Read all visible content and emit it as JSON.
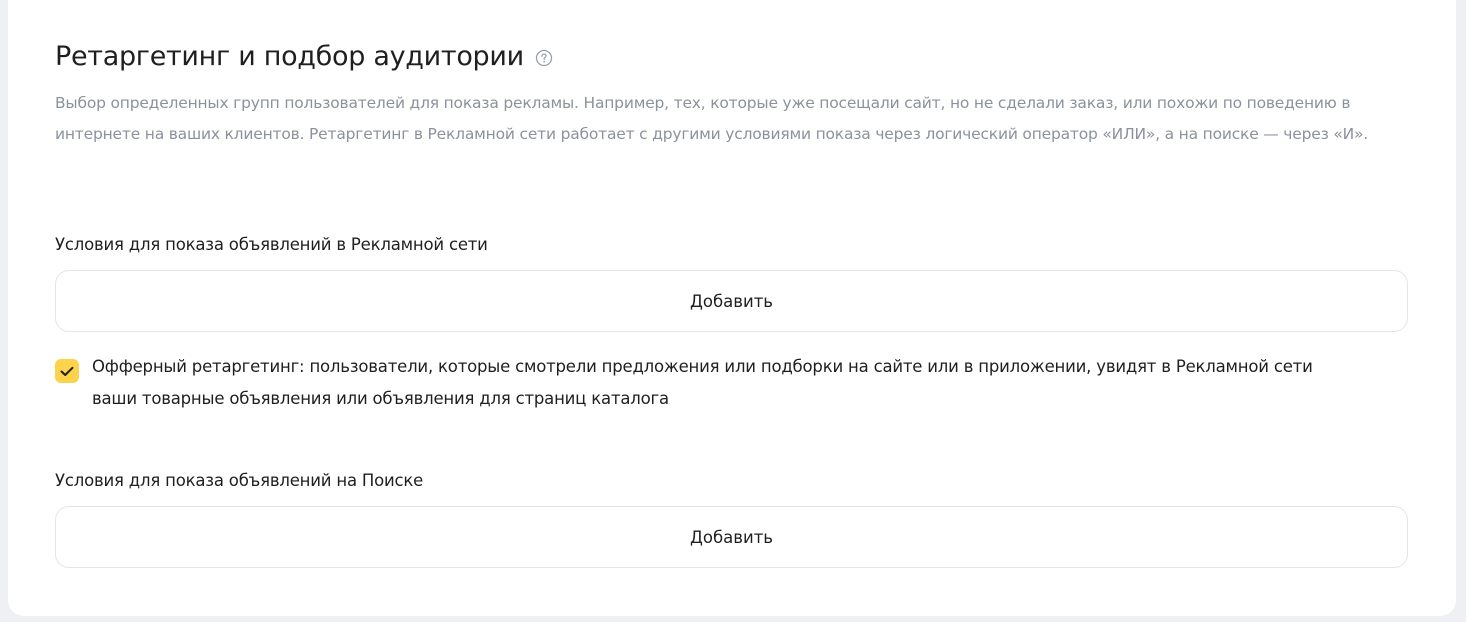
{
  "section": {
    "title": "Ретаргетинг и подбор аудитории",
    "help_icon": "question-circle-icon",
    "description": "Выбор определенных групп пользователей для показа рекламы. Например, тех, которые уже посещали сайт, но не сделали заказ, или похожи по поведению в интернете на ваших клиентов. Ретаргетинг в Рекламной сети работает с другими условиями показа через логический оператор «ИЛИ», а на поиске — через «И»."
  },
  "network_conditions": {
    "label": "Условия для показа объявлений в Рекламной сети",
    "add_button": "Добавить"
  },
  "offer_retargeting": {
    "checked": true,
    "text": "Офферный ретаргетинг: пользователи, которые смотрели предложения или подборки на сайте или в приложении, увидят в Рекламной сети ваши товарные объявления или объявления для страниц каталога"
  },
  "search_conditions": {
    "label": "Условия для показа объявлений на Поиске",
    "add_button": "Добавить"
  },
  "colors": {
    "checkbox_accent": "#fcd34a",
    "description_text": "#8b929c",
    "page_background": "#eef0f3"
  }
}
